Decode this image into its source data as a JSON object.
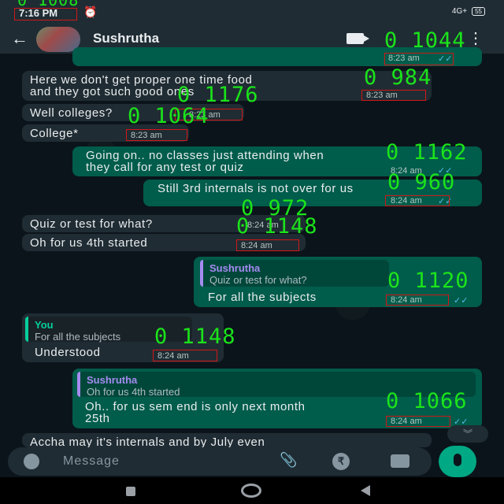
{
  "status_bar": {
    "time": "7:16 PM",
    "network": "4G+",
    "battery": "55"
  },
  "header": {
    "contact_name": "Sushrutha"
  },
  "ocr_labels": {
    "top_partial": "0 1008",
    "m1": "0 1044",
    "m2": "0 984",
    "m3": "0 1176",
    "m4": "0 1064",
    "m5": "0 1162",
    "m6": "0 960",
    "m7": "0 972",
    "m8": "0 1148",
    "m9": "0 1120",
    "m10": "0 1148",
    "m11": "0 1066"
  },
  "messages": [
    {
      "id": "m0",
      "direction": "out",
      "text": "",
      "time": "8:23 am"
    },
    {
      "id": "m1",
      "direction": "in",
      "line1": "Here we don't get proper one time food",
      "line2": "and they got such good ones",
      "time": "8:23 am"
    },
    {
      "id": "m2",
      "direction": "in",
      "text": "Well colleges?",
      "time": "8:23 am"
    },
    {
      "id": "m3",
      "direction": "in",
      "text": "College*",
      "time": "8:23 am"
    },
    {
      "id": "m4",
      "direction": "out",
      "line1": "Going on.. no classes just attending when",
      "line2": "they call for any test or quiz",
      "time": "8:24 am"
    },
    {
      "id": "m5",
      "direction": "out",
      "text": "Still 3rd internals is not over for us",
      "time": "8:24 am"
    },
    {
      "id": "m6",
      "direction": "in",
      "text": "Quiz or test for what?",
      "time": "8:24 am"
    },
    {
      "id": "m7",
      "direction": "in",
      "text": "Oh for us 4th started",
      "time": "8:24 am"
    },
    {
      "id": "m8",
      "direction": "out",
      "quote_author": "Sushrutha",
      "quote_text": "Quiz or test for what?",
      "text": "For all the subjects",
      "time": "8:24 am"
    },
    {
      "id": "m9",
      "direction": "in",
      "quote_author": "You",
      "quote_text": "For all the subjects",
      "text": "Understood",
      "time": "8:24 am"
    },
    {
      "id": "m10",
      "direction": "out",
      "quote_author": "Sushrutha",
      "quote_text": "Oh for us 4th started",
      "line1": "Oh.. for us sem end is only next month",
      "line2": "25th",
      "time": "8:24 am"
    },
    {
      "id": "m11",
      "direction": "in",
      "text": "Accha may it's internals and by July even"
    }
  ],
  "composer": {
    "placeholder": "Message",
    "rupee_symbol": "₹"
  },
  "icons": {
    "back": "back-arrow-icon",
    "video": "video-call-icon",
    "menu": "more-vert-icon",
    "emoji": "emoji-icon",
    "attach": "attach-icon",
    "rupee": "payment-icon",
    "camera": "camera-icon",
    "mic": "mic-icon",
    "scroll": "scroll-down-icon"
  },
  "colors": {
    "incoming": "#202c33",
    "outgoing": "#005c4b",
    "accent": "#00a884",
    "ocr_box": "#d01818",
    "ocr_text": "#1be31b"
  }
}
